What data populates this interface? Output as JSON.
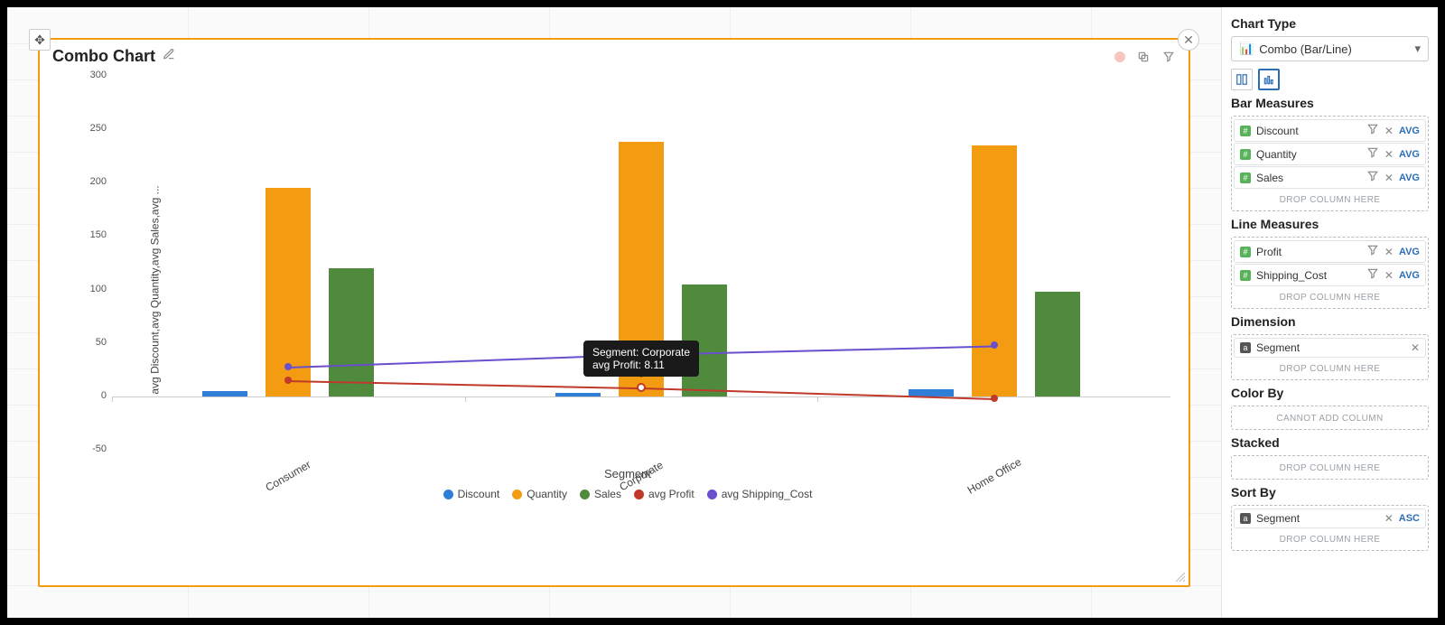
{
  "chart_data": {
    "type": "combo-bar-line",
    "title": "Combo Chart",
    "xlabel": "Segment",
    "ylabel": "avg Discount,avg Quantity,avg Sales,avg ...",
    "categories": [
      "Consumer",
      "Corporate",
      "Home Office"
    ],
    "yticks": [
      -50,
      0,
      50,
      100,
      150,
      200,
      250,
      300
    ],
    "ylim": [
      -50,
      300
    ],
    "bar_series": [
      {
        "name": "Discount",
        "color": "#2f7ed8",
        "values": [
          5,
          3,
          7
        ]
      },
      {
        "name": "Quantity",
        "color": "#f39c12",
        "values": [
          195,
          238,
          235
        ]
      },
      {
        "name": "Sales",
        "color": "#4f8a3d",
        "values": [
          120,
          105,
          98
        ]
      }
    ],
    "line_series": [
      {
        "name": "avg Profit",
        "color": "#c0392b",
        "values": [
          15,
          8.11,
          -2
        ]
      },
      {
        "name": "avg Shipping_Cost",
        "color": "#6a4fcf",
        "values": [
          28,
          40,
          48
        ]
      }
    ],
    "tooltip": {
      "category": "Corporate",
      "series": "avg Profit",
      "value": 8.11,
      "line1": "Segment:  Corporate",
      "line2": "avg Profit:  8.11"
    }
  },
  "legend": {
    "discount": "Discount",
    "quantity": "Quantity",
    "sales": "Sales",
    "profit": "avg Profit",
    "shipping": "avg Shipping_Cost"
  },
  "panel": {
    "chart_type_label": "Chart Type",
    "chart_type_value": "Combo (Bar/Line)",
    "bar_measures_label": "Bar Measures",
    "line_measures_label": "Line Measures",
    "dimension_label": "Dimension",
    "color_by_label": "Color By",
    "stacked_label": "Stacked",
    "sort_by_label": "Sort By",
    "drop_hint": "DROP COLUMN HERE",
    "cannot_add": "CANNOT ADD COLUMN",
    "agg": "AVG",
    "asc": "ASC",
    "bar_measures": [
      "Discount",
      "Quantity",
      "Sales"
    ],
    "line_measures": [
      "Profit",
      "Shipping_Cost"
    ],
    "dimension": "Segment",
    "sort_field": "Segment"
  }
}
